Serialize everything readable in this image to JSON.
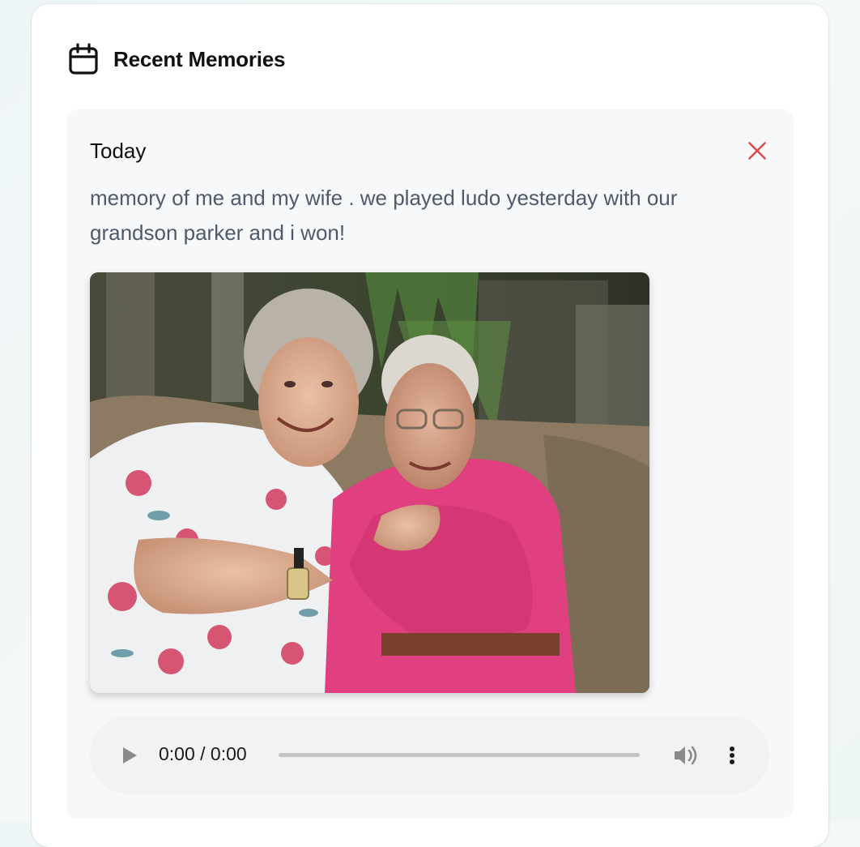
{
  "section": {
    "title": "Recent Memories",
    "icon": "calendar-icon"
  },
  "memory": {
    "date": "Today",
    "text": "memory of me and my wife . we played ludo yesterday with our grandson parker and i won!",
    "delete_icon": "close-icon",
    "photo_icon": "photo-elderly-couple",
    "audio": {
      "time": "0:00 / 0:00",
      "progress": 0,
      "play_icon": "play-icon",
      "volume_icon": "volume-icon",
      "menu_icon": "more-vertical-icon"
    }
  },
  "colors": {
    "delete": "#e04848",
    "text_muted": "#4e5a6b",
    "card_bg": "#ffffff",
    "memory_bg": "#f7f8fa"
  }
}
